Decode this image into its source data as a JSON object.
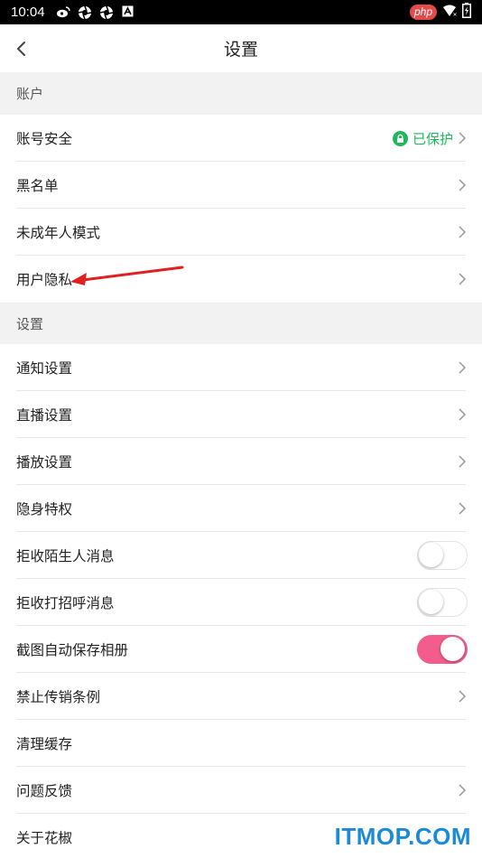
{
  "status_bar": {
    "time": "10:04",
    "left_icons": [
      "weibo-icon",
      "aperture-icon",
      "aperture-icon",
      "notification-a-icon"
    ],
    "badge": "php",
    "right_icons": [
      "wifi-icon",
      "battery-icon"
    ]
  },
  "nav": {
    "title": "设置",
    "back_icon": "chevron-left-icon"
  },
  "sections": {
    "account": {
      "header": "账户",
      "items": [
        {
          "label": "账号安全",
          "status": "已保护"
        },
        {
          "label": "黑名单"
        },
        {
          "label": "未成年人模式"
        },
        {
          "label": "用户隐私"
        }
      ]
    },
    "settings": {
      "header": "设置",
      "items": [
        {
          "label": "通知设置"
        },
        {
          "label": "直播设置"
        },
        {
          "label": "播放设置"
        },
        {
          "label": "隐身特权"
        },
        {
          "label": "拒收陌生人消息",
          "toggle": false
        },
        {
          "label": "拒收打招呼消息",
          "toggle": false
        },
        {
          "label": "截图自动保存相册",
          "toggle": true
        },
        {
          "label": "禁止传销条例"
        },
        {
          "label": "清理缓存"
        },
        {
          "label": "问题反馈"
        },
        {
          "label": "关于花椒"
        }
      ]
    }
  },
  "colors": {
    "protected_green": "#1cb85b",
    "toggle_on": "#f25d8e",
    "section_bg": "#f2f2f2",
    "annotation_arrow": "#e02020",
    "watermark": "#1c8bd6"
  },
  "watermark": "ITMOP.COM"
}
